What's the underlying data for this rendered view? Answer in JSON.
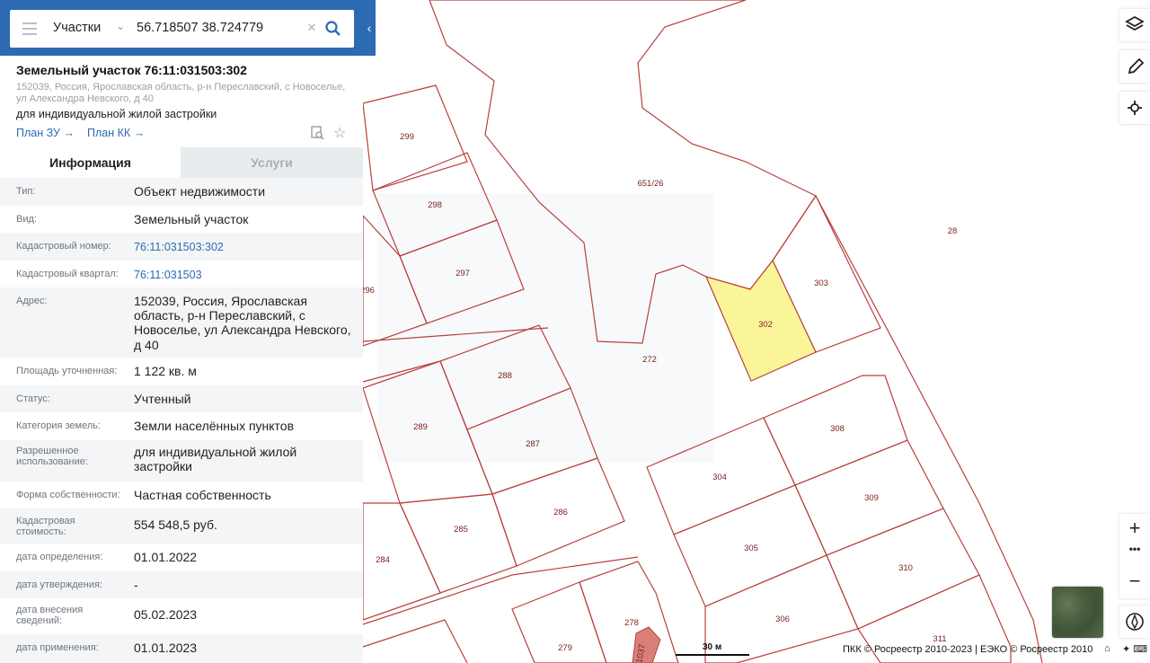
{
  "search": {
    "type_label": "Участки",
    "query": "56.718507 38.724779"
  },
  "card": {
    "title": "Земельный участок 76:11:031503:302",
    "address": "152039, Россия, Ярославская область, р-н Переславский, с Новоселье, ул Александра Невского, д 40",
    "use": "для индивидуальной жилой застройки",
    "link_plan_zu": "План ЗУ",
    "link_plan_kk": "План КК",
    "arrow": "→"
  },
  "tabs": {
    "info": "Информация",
    "services": "Услуги"
  },
  "rows": [
    {
      "label": "Тип:",
      "value": "Объект недвижимости"
    },
    {
      "label": "Вид:",
      "value": "Земельный участок"
    },
    {
      "label": "Кадастровый номер:",
      "value": "76:11:031503:302"
    },
    {
      "label": "Кадастровый квартал:",
      "value": "76:11:031503"
    },
    {
      "label": "Адрес:",
      "value": "152039, Россия, Ярославская область, р-н Переславский, с Новоселье, ул Александра Невского, д 40"
    },
    {
      "label": "Площадь уточненная:",
      "value": "1 122 кв. м"
    },
    {
      "label": "Статус:",
      "value": "Учтенный"
    },
    {
      "label": "Категория земель:",
      "value": "Земли населённых пунктов"
    },
    {
      "label": "Разрешенное использование:",
      "value": "для индивидуальной жилой застройки"
    },
    {
      "label": "Форма собственности:",
      "value": "Частная собственность"
    },
    {
      "label": "Кадастровая стоимость:",
      "value": "554 548,5 руб."
    },
    {
      "label": "дата определения:",
      "value": "01.01.2022"
    },
    {
      "label": "дата утверждения:",
      "value": "-"
    },
    {
      "label": "дата внесения сведений:",
      "value": "05.02.2023"
    },
    {
      "label": "дата применения:",
      "value": "01.01.2023"
    }
  ],
  "map": {
    "parcel_labels": [
      "299",
      "298",
      "297",
      "296",
      "651/26",
      "28",
      "303",
      "302",
      "272",
      "288",
      "289",
      "287",
      "286",
      "285",
      "284",
      "304",
      "305",
      "306",
      "308",
      "309",
      "310",
      "311",
      "278",
      "279",
      "1037"
    ],
    "selected_parcel": "302",
    "selected_fill": "#fbf59a",
    "boundary_color": "#b8413c",
    "scale_label": "30 м",
    "attribution": "ПКК © Росреестр 2010-2023 | ЕЭКО © Росреестр 2010",
    "zoom_in": "+",
    "zoom_out": "−"
  },
  "colors": {
    "header_blue": "#2c6ab4",
    "link_blue": "#2c6ab4"
  }
}
